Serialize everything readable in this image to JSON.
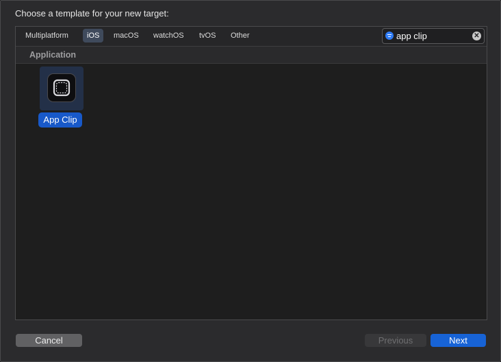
{
  "dialog": {
    "prompt": "Choose a template for your new target:"
  },
  "tabs": [
    {
      "label": "Multiplatform",
      "selected": false
    },
    {
      "label": "iOS",
      "selected": true
    },
    {
      "label": "macOS",
      "selected": false
    },
    {
      "label": "watchOS",
      "selected": false
    },
    {
      "label": "tvOS",
      "selected": false
    },
    {
      "label": "Other",
      "selected": false
    }
  ],
  "search": {
    "value": "app clip",
    "icon": "filter-icon",
    "clear_icon": "clear-circle-icon"
  },
  "section": {
    "title": "Application"
  },
  "templates": [
    {
      "label": "App Clip",
      "icon": "app-clip-icon",
      "selected": true
    }
  ],
  "buttons": {
    "cancel": "Cancel",
    "previous": "Previous",
    "next": "Next"
  },
  "colors": {
    "accent": "#1763d6",
    "selection": "#1859c9",
    "background": "#1e1e1e"
  }
}
